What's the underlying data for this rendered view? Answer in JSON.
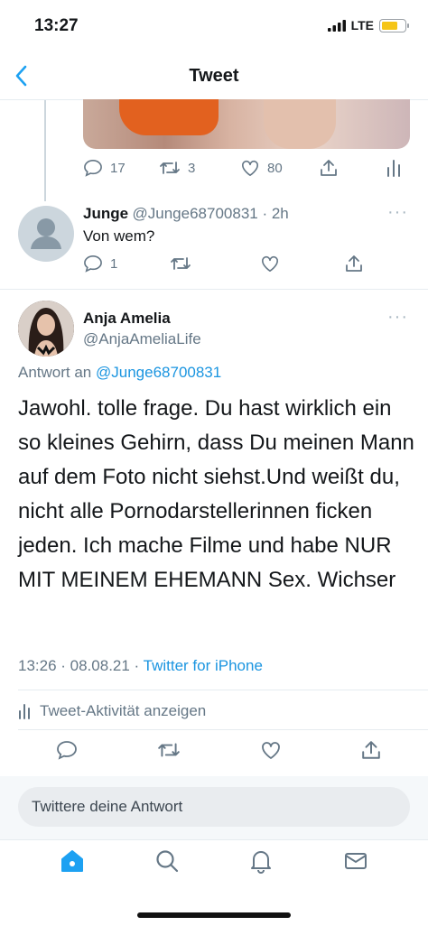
{
  "status_bar": {
    "time": "13:27",
    "network": "LTE",
    "battery_level": 0.7
  },
  "header": {
    "title": "Tweet"
  },
  "prev_tweet": {
    "stats": {
      "replies": "17",
      "retweets": "3",
      "likes": "80"
    }
  },
  "reply": {
    "name": "Junge",
    "handle_time": "@Junge68700831 · 2h",
    "text": "Von wem?",
    "reply_count": "1"
  },
  "main_tweet": {
    "name": "Anja Amelia",
    "handle": "@AnjaAmeliaLife",
    "replying_prefix": "Antwort an ",
    "replying_to": "@Junge68700831",
    "text": "Jawohl.  tolle frage.  Du hast wirklich ein so kleines Gehirn, dass Du  meinen Mann auf dem Foto nicht siehst.Und weißt du, nicht alle Pornodarstellerinnen ficken jeden.  Ich mache Filme und habe NUR MIT MEINEM EHEMANN Sex.  Wichser",
    "timestamp": "13:26 · 08.08.21 · ",
    "source": "Twitter for iPhone",
    "activity_label": "Tweet-Aktivität anzeigen"
  },
  "compose": {
    "placeholder": "Twittere deine Antwort"
  },
  "tab_bar": [
    "home-icon",
    "search-icon",
    "notifications-icon",
    "messages-icon"
  ],
  "colors": {
    "accent": "#1da1f2",
    "muted": "#657786",
    "divider": "#e6ecf0"
  }
}
